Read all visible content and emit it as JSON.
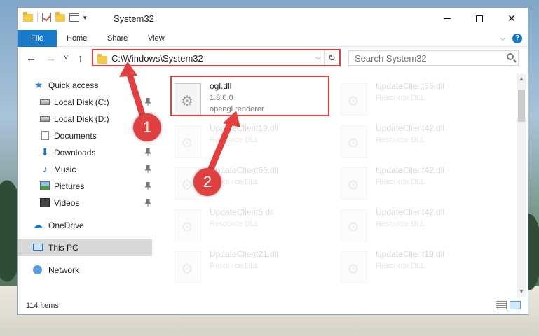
{
  "window": {
    "title": "System32",
    "minimize_label": "─",
    "maximize_label": "☐",
    "close_label": "✕"
  },
  "ribbon": {
    "tabs": [
      "File",
      "Home",
      "Share",
      "View"
    ]
  },
  "nav": {
    "back_label": "←",
    "forward_label": "→",
    "recent_label": "˅",
    "up_label": "↑",
    "address": "C:\\Windows\\System32",
    "refresh_label": "↻",
    "search_placeholder": "Search System32"
  },
  "sidebar": {
    "items": [
      {
        "label": "Quick access",
        "icon": "star-icon"
      },
      {
        "label": "Local Disk (C:)",
        "icon": "drive-icon",
        "pinned": true
      },
      {
        "label": "Local Disk (D:)",
        "icon": "drive-icon"
      },
      {
        "label": "Documents",
        "icon": "documents-icon"
      },
      {
        "label": "Downloads",
        "icon": "downloads-icon",
        "pinned": true
      },
      {
        "label": "Music",
        "icon": "music-icon",
        "pinned": true
      },
      {
        "label": "Pictures",
        "icon": "pictures-icon",
        "pinned": true
      },
      {
        "label": "Videos",
        "icon": "videos-icon",
        "pinned": true
      },
      {
        "label": "OneDrive",
        "icon": "onedrive-icon"
      },
      {
        "label": "This PC",
        "icon": "pc-icon",
        "selected": true
      },
      {
        "label": "Network",
        "icon": "network-icon"
      }
    ]
  },
  "files": [
    {
      "name": "ogl.dll",
      "line2": "1.8.0.0",
      "line3": "opengl renderer",
      "highlighted": true
    },
    {
      "name": "UpdateClient65.dll",
      "line2": "Resource DLL"
    },
    {
      "name": "UpdateClient19.dll",
      "line2": "Resource DLL"
    },
    {
      "name": "UpdateClient42.dll",
      "line2": "Resource DLL"
    },
    {
      "name": "UpdateClient65.dll",
      "line2": "Resource DLL"
    },
    {
      "name": "UpdateClient42.dll",
      "line2": "Resource DLL"
    },
    {
      "name": "UpdateClient5.dll",
      "line2": "Resource DLL"
    },
    {
      "name": "UpdateClient42.dll",
      "line2": "Resource DLL"
    },
    {
      "name": "UpdateClient21.dll",
      "line2": "Resource DLL"
    },
    {
      "name": "UpdateClient19.dll",
      "line2": "Resource DLL"
    }
  ],
  "status": {
    "item_count": "114 items"
  },
  "callouts": [
    "1",
    "2"
  ],
  "colors": {
    "accent": "#1979ca",
    "highlight": "#e04040"
  }
}
